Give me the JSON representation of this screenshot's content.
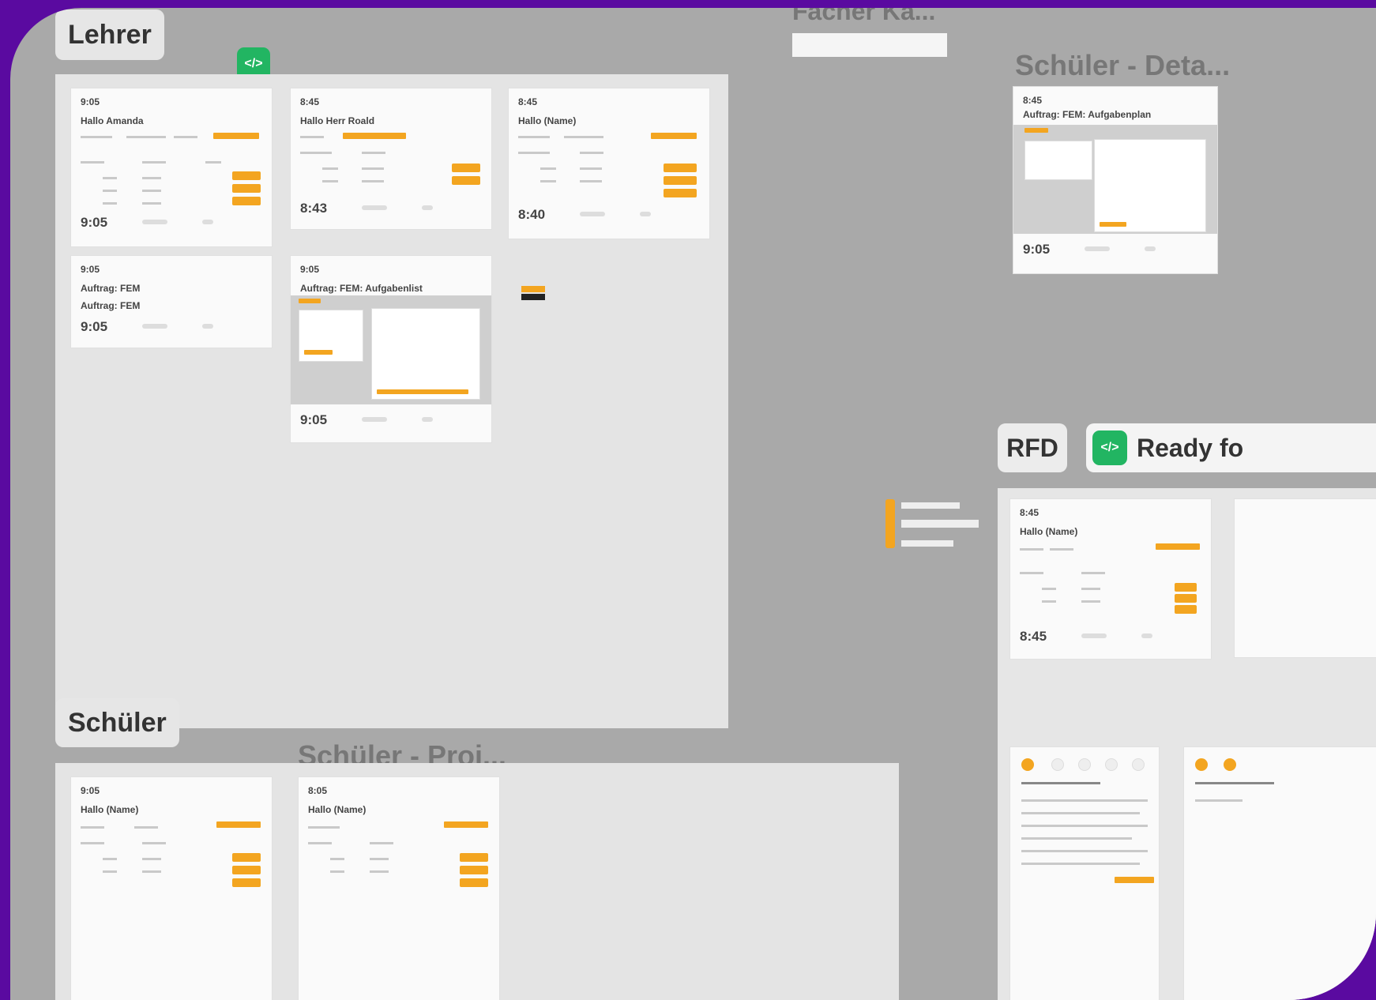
{
  "canvas": {
    "background": "#a9a9a9",
    "frame": "#5a0aa0",
    "accent": "#f3a520",
    "green": "#22b562"
  },
  "labels": {
    "lehrer": "Lehrer",
    "schueler": "Schüler",
    "rfd": "RFD",
    "ready": "Ready fo",
    "faecher_kachel": "Fächer Ka...",
    "schueler_detail": "Schüler - Deta...",
    "schueler_proj": "Schüler - Proj..."
  },
  "lehrer_cards": [
    {
      "time": "9:05",
      "name": "Hallo Amanda",
      "foot_time": "9:05"
    },
    {
      "time": "8:45",
      "name": "Hallo Herr Roald",
      "foot_time": "8:43"
    },
    {
      "time": "8:45",
      "name": "Hallo (Name)",
      "foot_time": "8:40"
    },
    {
      "time": "9:05",
      "name": "Auftrag: FEM",
      "name2": "Auftrag: FEM",
      "foot_time": "9:05"
    },
    {
      "time": "9:05",
      "name": "Auftrag: FEM: Aufgabenlist",
      "foot_time": "9:05"
    }
  ],
  "schueler_cards": [
    {
      "time": "9:05",
      "name": "Hallo (Name)"
    },
    {
      "time": "8:05",
      "name": "Hallo (Name)"
    }
  ],
  "detail_card": {
    "time": "8:45",
    "name": "Auftrag: FEM: Aufgabenplan",
    "foot_time": "9:05"
  },
  "rfd_card": {
    "time": "8:45",
    "name": "Hallo (Name)",
    "foot_time": "8:45"
  },
  "icons": {
    "code": "code-icon"
  }
}
